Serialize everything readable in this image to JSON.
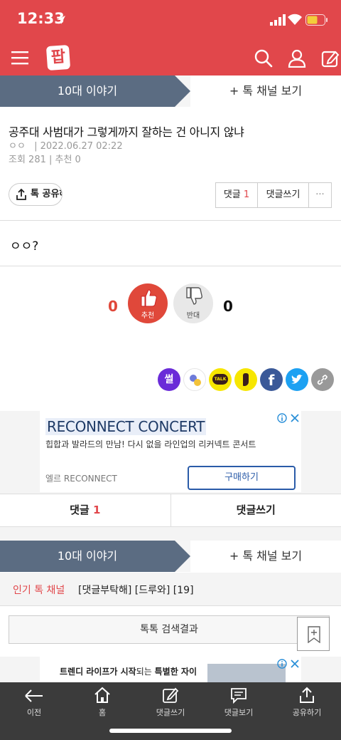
{
  "status": {
    "time": "12:33"
  },
  "header": {
    "logo": "팝"
  },
  "channel": {
    "name": "10대 이야기",
    "view_label": "+ 톡 채널 보기"
  },
  "post": {
    "title": "공주대 사범대가 그렇게까지 잘하는 건 아니지 않냐",
    "author": "ㅇㅇ",
    "date": "| 2022.06.27 02:22",
    "views": "조회 281 | 추천 0",
    "body": "ㅇㅇ?"
  },
  "actions": {
    "share_label": "톡 공유하기",
    "comment_label": "댓글",
    "comment_count": "1",
    "write_comment": "댓글쓰기",
    "more": "···"
  },
  "votes": {
    "up_count": "0",
    "up_label": "추천",
    "down_count": "0",
    "down_label": "반대"
  },
  "sns": {
    "sul": "썰",
    "talk": "TALK"
  },
  "ad": {
    "title": "RECONNECT CONCERT",
    "desc": "힙합과 발라드의 만남! 다시 없을 라인업의 리커넥트 콘서트",
    "sponsor": "엘르 RECONNECT",
    "cta": "구매하기"
  },
  "tabs": {
    "comments": "댓글",
    "comments_count": "1",
    "write": "댓글쓰기"
  },
  "popular": {
    "label": "인기 톡 채널",
    "text": "[댓글부탁해] [드루와] [19]"
  },
  "search_result": "톡톡 검색결과",
  "ad2": {
    "text_a": "트렌디 라이프가 시작",
    "text_b": "되는 ",
    "text_c": "특별한 자이"
  },
  "nav": {
    "back": "이전",
    "home": "홈",
    "write": "댓글쓰기",
    "view": "댓글보기",
    "share": "공유하기"
  },
  "colors": {
    "brand": "#e1474b",
    "channel_tab": "#5b6c82",
    "vote_up": "#e0483a",
    "cta": "#2a5ba8"
  }
}
